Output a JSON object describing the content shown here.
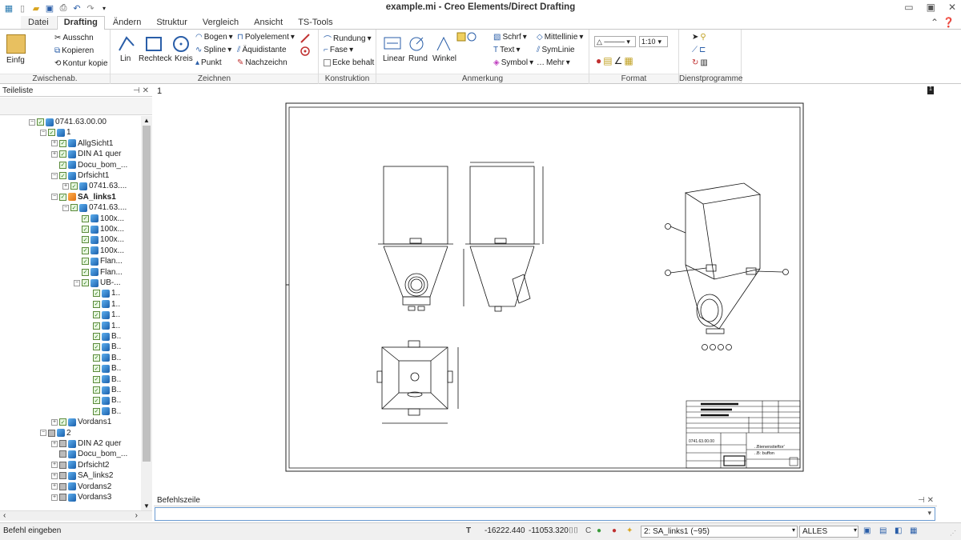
{
  "window": {
    "title": "example.mi - Creo Elements/Direct Drafting"
  },
  "tabs": [
    "Datei",
    "Drafting",
    "Ändern",
    "Struktur",
    "Vergleich",
    "Ansicht",
    "TS-Tools"
  ],
  "ribbon": {
    "groups": [
      "Zwischenab.",
      "Zeichnen",
      "Konstruktion",
      "Anmerkung",
      "Format",
      "Dienstprogramme"
    ],
    "clipboard": {
      "paste": "Einfg",
      "cut": "Ausschn",
      "copy": "Kopieren",
      "copy_contour": "Kontur kopie"
    },
    "draw": {
      "line": "Lin",
      "rect": "Rechteck",
      "circle": "Kreis",
      "arc": "Bogen",
      "spline": "Spline",
      "point": "Punkt",
      "polyline": "Polyelement",
      "equidistant": "Äquidistante",
      "trace": "Nachzeichn"
    },
    "construct": {
      "fillet": "Rundung",
      "chamfer": "Fase",
      "corner": "Ecke behalt"
    },
    "annotate": {
      "linear": "Linear",
      "round": "Rund",
      "angle": "Winkel",
      "hatch": "Schrf",
      "text": "Text",
      "symbol": "Symbol",
      "centerline": "Mittellinie",
      "symline": "SymLinie",
      "more": "Mehr"
    },
    "format": {
      "scale": "1:10"
    }
  },
  "tree": {
    "header": "Teileliste",
    "nodes": [
      "0741.63.00.00",
      "1",
      "AllgSicht1",
      "DIN A1 quer",
      "Docu_bom_...",
      "Drfsicht1",
      "0741.63....",
      "SA_links1",
      "0741.63....",
      "100x...",
      "100x...",
      "100x...",
      "100x...",
      "Flan...",
      "Flan...",
      "UB-...",
      "1..",
      "1..",
      "1..",
      "1..",
      "B..",
      "B..",
      "B..",
      "B..",
      "B..",
      "B..",
      "B..",
      "B..",
      "Vordans1",
      "2",
      "DIN A2 quer",
      "Docu_bom_...",
      "Drfsicht2",
      "SA_links2",
      "Vordans2",
      "Vordans3"
    ]
  },
  "viewport": {
    "number": "1"
  },
  "command": {
    "header": "Befehlszeile"
  },
  "status": {
    "prompt": "Befehl eingeben",
    "x": "-16222.440",
    "y": "-11053.320",
    "active_part": "2: SA_links1 (~95)",
    "filter": "ALLES"
  },
  "titleblock": {
    "line1": "..Bienenstieftor'",
    "line2": "..B: buffon",
    "code": "0741.63.00.00"
  }
}
